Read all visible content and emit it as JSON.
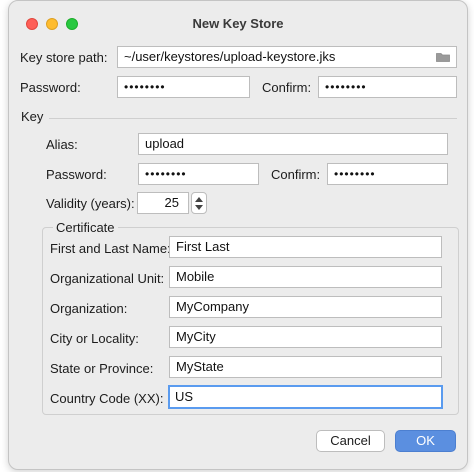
{
  "window": {
    "title": "New Key Store"
  },
  "keystore": {
    "path_label": "Key store path:",
    "path_value": "~/user/keystores/upload-keystore.jks",
    "password_label": "Password:",
    "password_value": "••••••••",
    "confirm_label": "Confirm:",
    "confirm_value": "••••••••"
  },
  "key": {
    "section_label": "Key",
    "alias_label": "Alias:",
    "alias_value": "upload",
    "password_label": "Password:",
    "password_value": "••••••••",
    "confirm_label": "Confirm:",
    "confirm_value": "••••••••",
    "validity_label": "Validity (years):",
    "validity_value": "25"
  },
  "certificate": {
    "legend": "Certificate",
    "fields": [
      {
        "label": "First and Last Name:",
        "value": "First Last"
      },
      {
        "label": "Organizational Unit:",
        "value": "Mobile"
      },
      {
        "label": "Organization:",
        "value": "MyCompany"
      },
      {
        "label": "City or Locality:",
        "value": "MyCity"
      },
      {
        "label": "State or Province:",
        "value": "MyState"
      },
      {
        "label": "Country Code (XX):",
        "value": "US"
      }
    ]
  },
  "buttons": {
    "cancel": "Cancel",
    "ok": "OK"
  },
  "icons": {
    "folder": "folder-icon",
    "stepper": "stepper-icon"
  },
  "colors": {
    "accent": "#5b8fe0",
    "focus": "#5a9bef",
    "close": "#fe5f57",
    "minimize": "#febc2e",
    "maximize": "#28c840"
  }
}
